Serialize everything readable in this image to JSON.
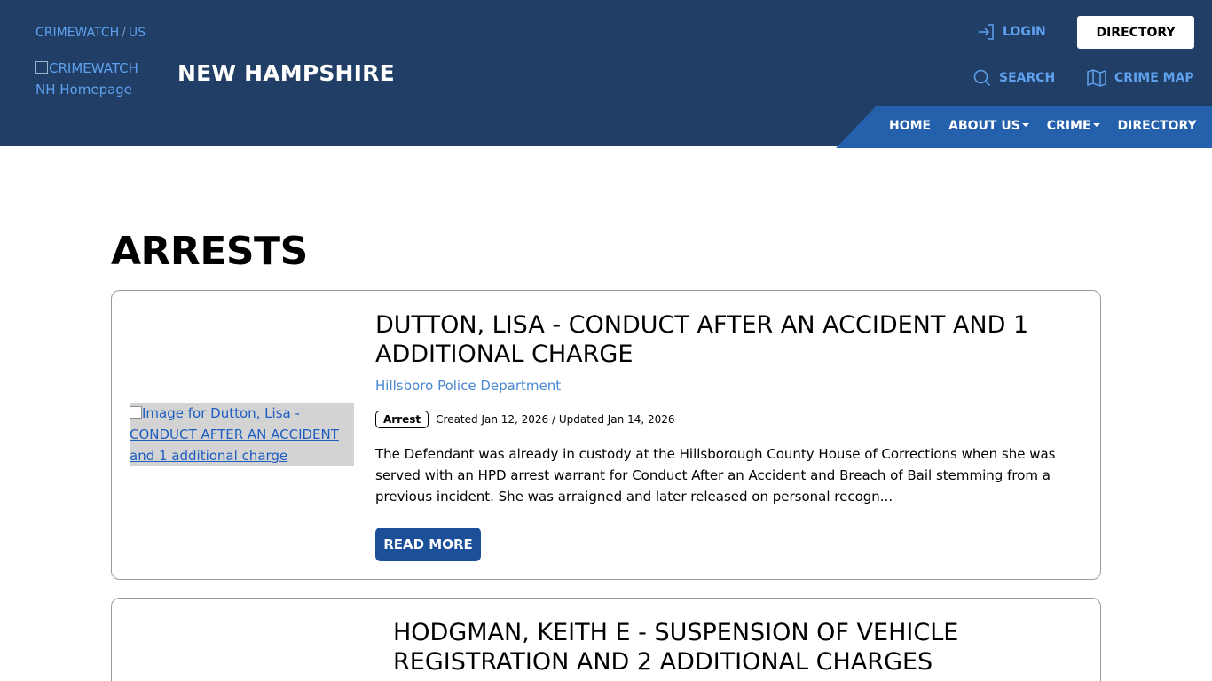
{
  "header": {
    "breadcrumb": [
      "CRIMEWATCH",
      "US"
    ],
    "logo_alt": "CRIMEWATCH NH Homepage",
    "site_title": "NEW HAMPSHIRE",
    "login_label": "LOGIN",
    "directory_button": "DIRECTORY",
    "search_label": "SEARCH",
    "crime_map_label": "CRIME MAP",
    "nav": [
      "HOME",
      "ABOUT US",
      "CRIME",
      "DIRECTORY"
    ],
    "colors": {
      "header_bg": "#203e66",
      "nav_bg": "#2560ac",
      "link": "#5fa1ee"
    }
  },
  "main": {
    "heading": "ARRESTS",
    "cards": [
      {
        "image_alt": "Image for Dutton, Lisa - CONDUCT AFTER AN ACCIDENT and 1 additional charge",
        "title": "DUTTON, LISA - CONDUCT AFTER AN ACCIDENT AND 1 ADDITIONAL CHARGE",
        "agency": "Hillsboro Police Department",
        "badge": "Arrest",
        "dates": "Created Jan 12, 2026 / Updated Jan 14, 2026",
        "description": "The Defendant was already in custody at the Hillsborough County House of Corrections when she was served with an HPD arrest warrant for Conduct After an Accident and Breach of Bail stemming from a previous incident.  She was arraigned and later released on personal recogn...",
        "read_more": "READ MORE"
      },
      {
        "title": "HODGMAN, KEITH E - SUSPENSION OF VEHICLE REGISTRATION AND 2 ADDITIONAL CHARGES"
      }
    ]
  }
}
